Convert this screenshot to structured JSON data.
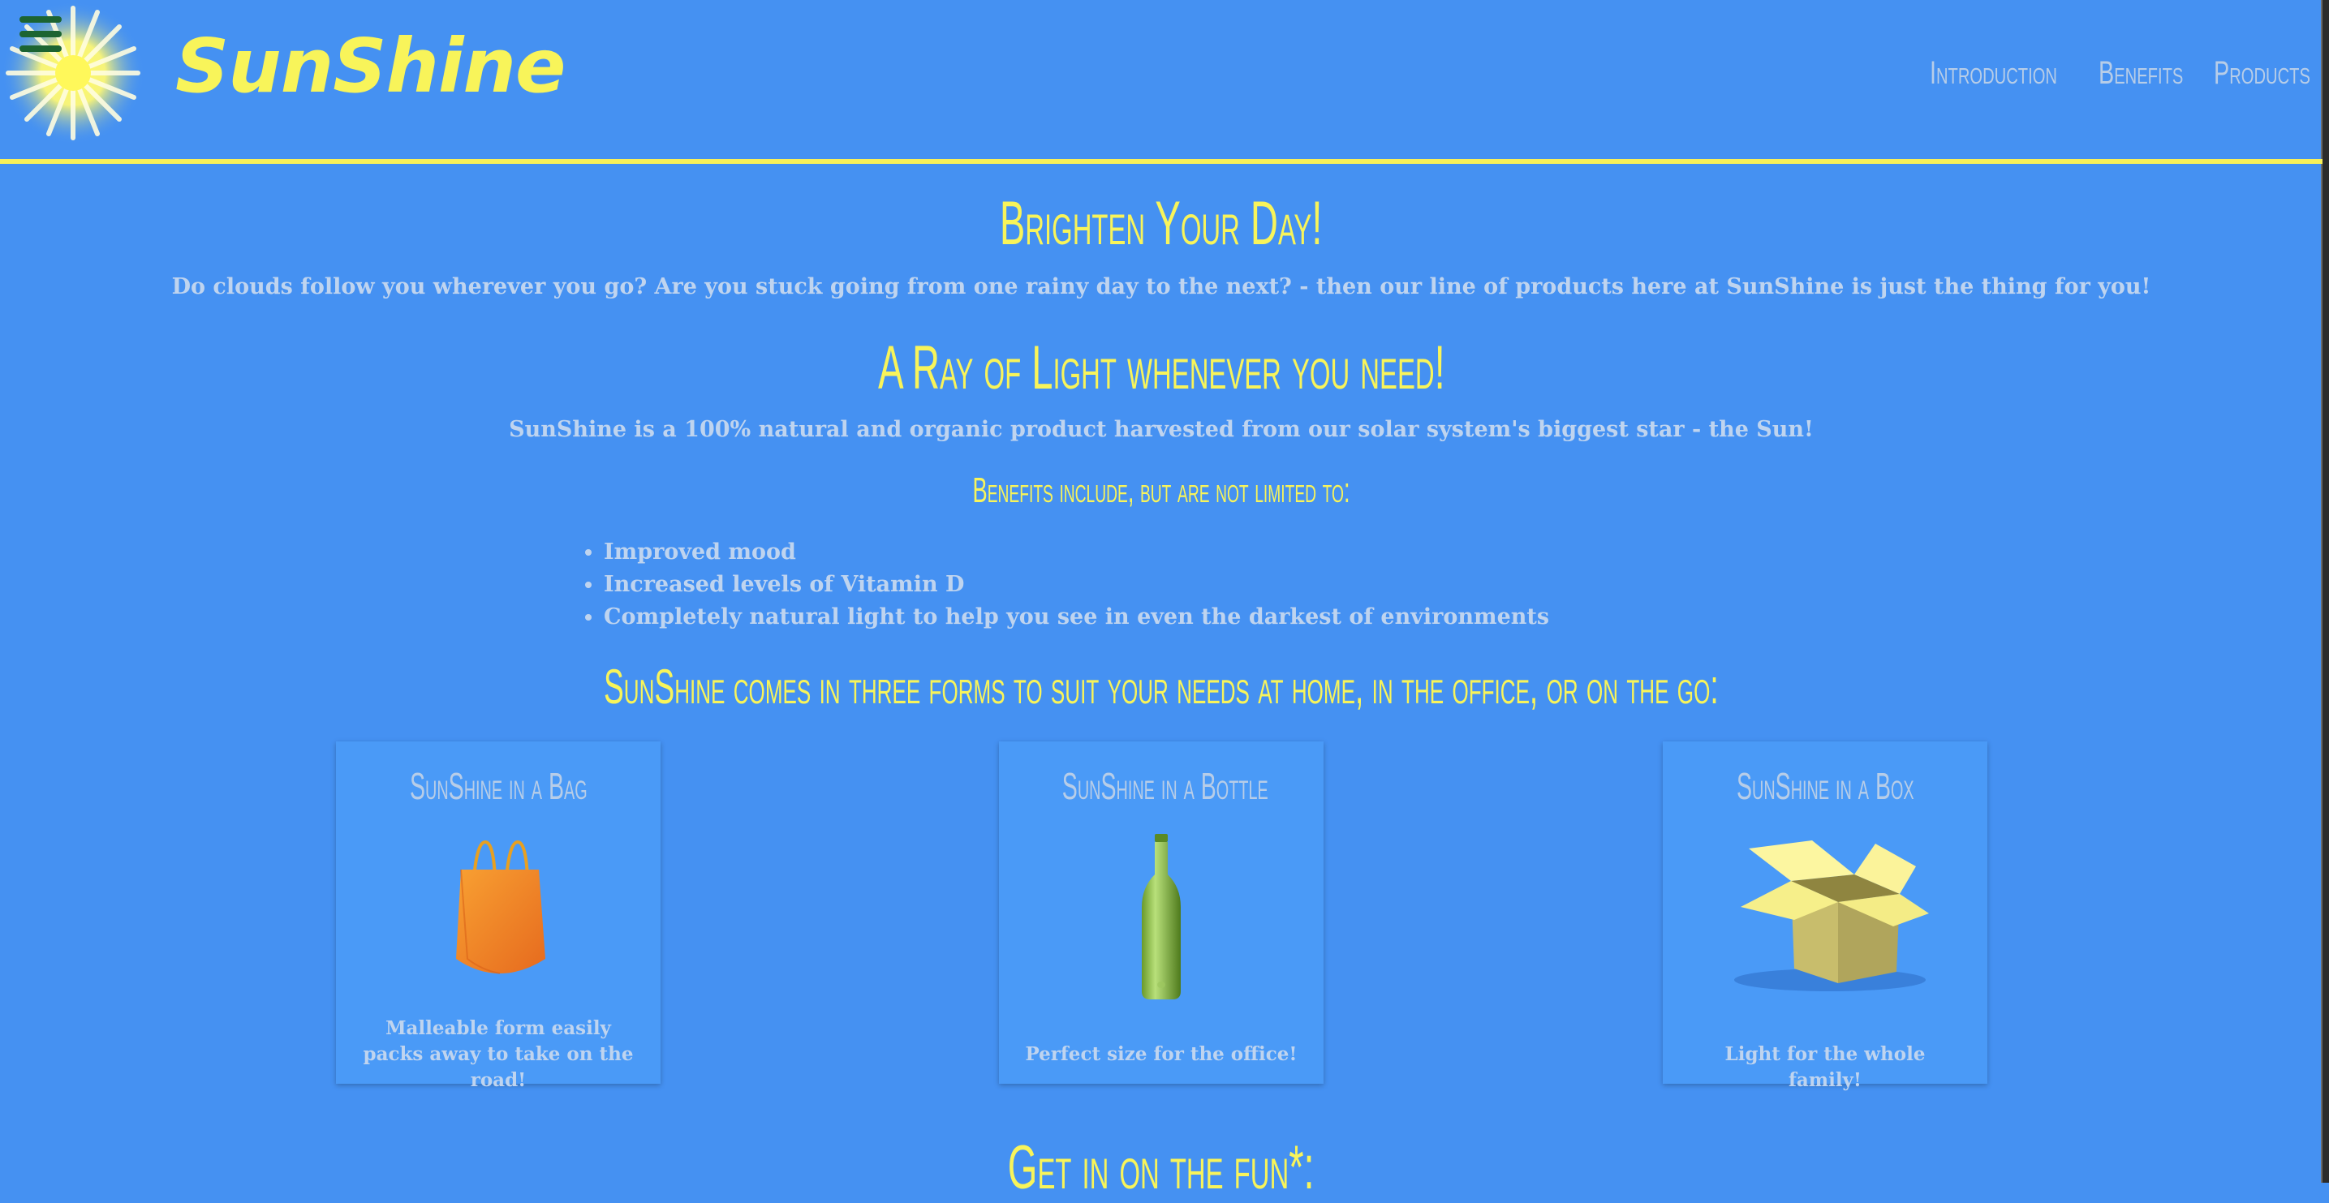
{
  "brand": {
    "name": "SunShine"
  },
  "nav": {
    "items": [
      "Introduction",
      "Benefits",
      "Products"
    ]
  },
  "intro": {
    "heading": "Brighten Your Day!",
    "text": "Do clouds follow you wherever you go? Are you stuck going from one rainy day to the next? - then our line of products here at SunShine is just the thing for you!"
  },
  "about": {
    "heading": "A Ray of Light whenever you need!",
    "text": "SunShine is a 100% natural and organic product harvested from our solar system's biggest star - the Sun!"
  },
  "benefits": {
    "heading": "Benefits include, but are not limited to:",
    "items": [
      "Improved mood",
      "Increased levels of Vitamin D",
      "Completely natural light to help you see in even the darkest of environments"
    ]
  },
  "products": {
    "heading": "SunShine comes in three forms to suit your needs at home, in the office, or on the go:",
    "cards": [
      {
        "title": "SunShine in a Bag",
        "desc": "Malleable form easily packs away to take on the road!",
        "icon": "shopping-bag"
      },
      {
        "title": "SunShine in a Bottle",
        "desc": "Perfect size for the office!",
        "icon": "bottle"
      },
      {
        "title": "SunShine in a Box",
        "desc": "Light for the whole family!",
        "icon": "box"
      }
    ]
  },
  "fun": {
    "heading": "Get in on the fun*:"
  },
  "colors": {
    "background": "#4591f2",
    "accent": "#f8f45a",
    "muted_text": "#bfd4ef",
    "menu_icon": "#1c6432"
  }
}
